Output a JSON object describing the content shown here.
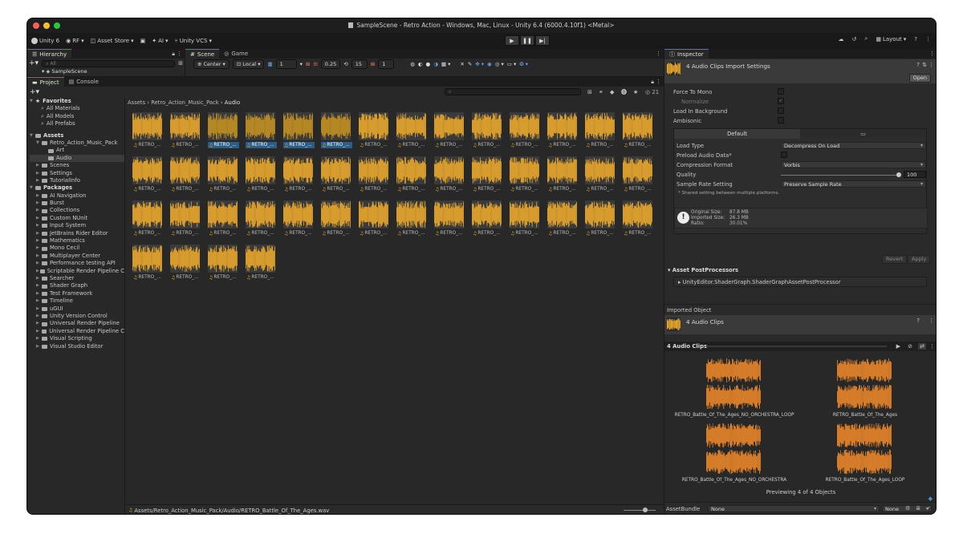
{
  "window": {
    "title": "SampleScene - Retro Action - Windows, Mac, Linux - Unity 6.4 (6000.4.10f1) <Metal>",
    "traffic_colors": [
      "#fe5f57",
      "#febc2e",
      "#28c840"
    ]
  },
  "toolbar": {
    "unity": "Unity 6",
    "account": "RF",
    "asset_store": "Asset Store",
    "ai": "AI",
    "vcs": "Unity VCS",
    "layout": "Layout"
  },
  "hierarchy": {
    "tab": "Hierarchy",
    "search_placeholder": "All",
    "scene": "SampleScene"
  },
  "scene_view": {
    "tab_scene": "Scene",
    "tab_game": "Game",
    "pivot": "Center",
    "space": "Local",
    "grid_value": "1",
    "snap_value": "0.25",
    "angle_value": "15",
    "scale_value": "1"
  },
  "project": {
    "tab_project": "Project",
    "tab_console": "Console",
    "count": "21",
    "breadcrumb": [
      "Assets",
      "Retro_Action_Music_Pack",
      "Audio"
    ],
    "favorites": {
      "label": "Favorites",
      "items": [
        "All Materials",
        "All Models",
        "All Prefabs"
      ]
    },
    "assets_label": "Assets",
    "assets_tree": [
      {
        "label": "Retro_Action_Music_Pack",
        "indent": 1,
        "open": true
      },
      {
        "label": "Art",
        "indent": 2,
        "open": false
      },
      {
        "label": "Audio",
        "indent": 2,
        "open": false,
        "selected": true
      },
      {
        "label": "Scenes",
        "indent": 1,
        "open": false
      },
      {
        "label": "Settings",
        "indent": 1,
        "open": false
      },
      {
        "label": "TutorialInfo",
        "indent": 1,
        "open": false
      }
    ],
    "packages_label": "Packages",
    "packages": [
      "AI Navigation",
      "Burst",
      "Collections",
      "Custom NUnit",
      "Input System",
      "JetBrains Rider Editor",
      "Mathematics",
      "Mono Cecil",
      "Multiplayer Center",
      "Performance testing API",
      "Scriptable Render Pipeline C",
      "Searcher",
      "Shader Graph",
      "Test Framework",
      "Timeline",
      "uGUI",
      "Unity Version Control",
      "Universal Render Pipeline",
      "Universal Render Pipeline C",
      "Visual Scripting",
      "Visual Studio Editor"
    ],
    "asset_label": "RETRO_...",
    "asset_count": 46,
    "selected_indices": [
      2,
      3,
      4,
      5
    ],
    "status_path": "Assets/Retro_Action_Music_Pack/Audio/RETRO_Battle_Of_The_Ages.wav"
  },
  "inspector": {
    "tab": "Inspector",
    "header": "4 Audio Clips Import Settings",
    "open_button": "Open",
    "force_to_mono": "Force To Mono",
    "normalize": "Normalize",
    "load_in_background": "Load In Background",
    "ambisonic": "Ambisonic",
    "platform_tab_default": "Default",
    "load_type_label": "Load Type",
    "load_type_value": "Decompress On Load",
    "preload_label": "Preload Audio Data*",
    "compression_label": "Compression Format",
    "compression_value": "Vorbis",
    "quality_label": "Quality",
    "quality_value": "100",
    "quality_fraction": 1.0,
    "sample_rate_label": "Sample Rate Setting",
    "sample_rate_value": "Preserve Sample Rate",
    "shared_note": "* Shared setting between multiple platforms.",
    "original_size_label": "Original Size:",
    "original_size": "87.8 MB",
    "imported_size_label": "Imported Size:",
    "imported_size": "26.3 MB",
    "ratio_label": "Ratio:",
    "ratio": "30.01%",
    "revert": "Revert",
    "apply": "Apply",
    "postprocessors_label": "Asset PostProcessors",
    "postprocessor_item": "UnityEditor.ShaderGraph.ShaderGraphAssetPostProcessor",
    "imported_object": "Imported Object",
    "imported_title": "4 Audio Clips",
    "preview_header": "4 Audio Clips",
    "channel1": "ch 1",
    "channel2": "ch 2",
    "clips": [
      "RETRO_Battle_Of_The_Ages_NO_ORCHESTRA_LOOP",
      "RETRO_Battle_Of_The_Ages",
      "RETRO_Battle_Of_The_Ages_NO_ORCHESTRA",
      "RETRO_Battle_Of_The_Ages_LOOP"
    ],
    "previewing": "Previewing 4 of 4 Objects",
    "assetbundle_label": "AssetBundle",
    "assetbundle_value": "None",
    "assetbundle_variant": "None"
  },
  "colors": {
    "waveform": "#f0ac2c",
    "waveform_selected": "#c99422",
    "preview_wave": "#f28a2b",
    "selection": "#2c5d87",
    "accent": "#3a7bd5"
  }
}
